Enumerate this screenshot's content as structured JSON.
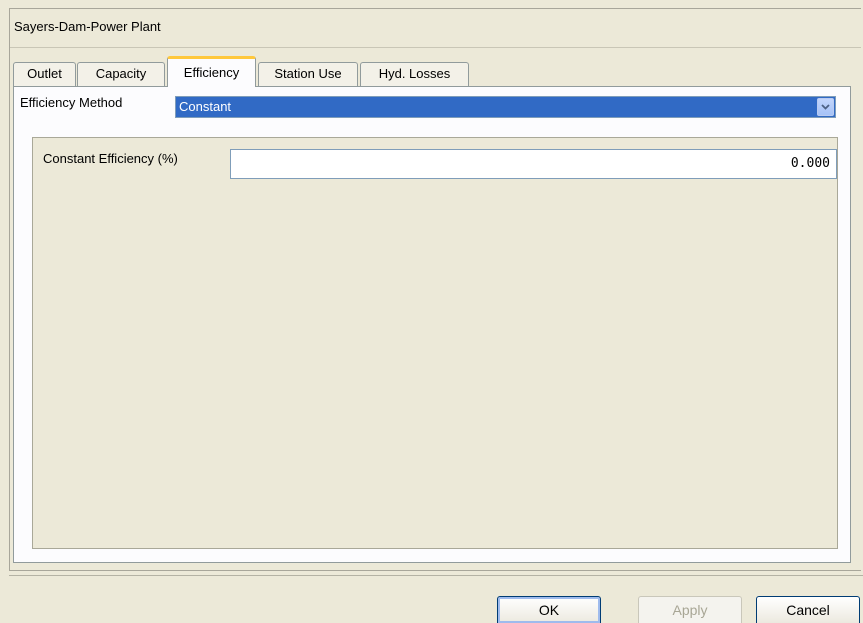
{
  "window": {
    "title": "Sayers-Dam-Power Plant"
  },
  "tabs": [
    {
      "label": "Outlet",
      "active": false
    },
    {
      "label": "Capacity",
      "active": false
    },
    {
      "label": "Efficiency",
      "active": true
    },
    {
      "label": "Station Use",
      "active": false
    },
    {
      "label": "Hyd. Losses",
      "active": false
    }
  ],
  "efficiency": {
    "method_label": "Efficiency Method",
    "method_value": "Constant",
    "dropdown_icon": "chevron-down-icon",
    "constant_label": "Constant Efficiency (%)",
    "constant_value": "0.000"
  },
  "buttons": {
    "ok": "OK",
    "apply": "Apply",
    "cancel": "Cancel"
  },
  "colors": {
    "selection": "#316ac5",
    "active_tab_accent": "#ffc83c",
    "background": "#ece9d8"
  }
}
